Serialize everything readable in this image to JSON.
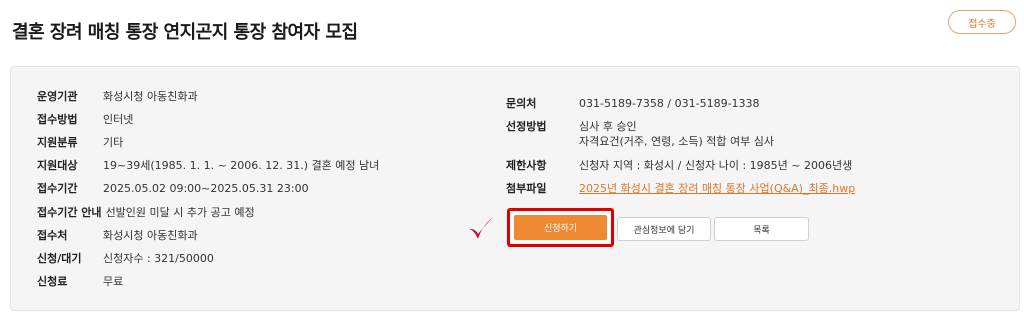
{
  "header": {
    "title": "결혼 장려 매칭 통장 연지곤지 통장 참여자 모집",
    "status": "접수중"
  },
  "info_left": [
    {
      "label": "운영기관",
      "value": "화성시청 아동친화과"
    },
    {
      "label": "접수방법",
      "value": "인터넷"
    },
    {
      "label": "지원분류",
      "value": "기타"
    },
    {
      "label": "지원대상",
      "value": "19~39세(1985. 1. 1. ~ 2006. 12. 31.) 결혼 예정 남녀"
    },
    {
      "label": "접수기간",
      "value": "2025.05.02 09:00~2025.05.31 23:00"
    },
    {
      "label": "접수기간 안내",
      "value": "선발인원 미달 시 추가 공고 예정"
    },
    {
      "label": "접수처",
      "value": "화성시청 아동친화과"
    },
    {
      "label": "신청/대기",
      "value": "신청자수 : 321/50000"
    },
    {
      "label": "신청료",
      "value": "무료"
    }
  ],
  "info_right": {
    "contact": {
      "label": "문의처",
      "value": "031-5189-7358 / 031-5189-1338"
    },
    "selection": {
      "label": "선정방법",
      "line1": "심사 후 승인",
      "line2": "자격요건(거주, 연령, 소득) 적합 여부 심사"
    },
    "restriction": {
      "label": "제한사항",
      "value": "신청자 지역 : 화성시 / 신청자 나이 : 1985년 ~ 2006년생"
    },
    "attachment": {
      "label": "첨부파일",
      "value": "2025년 화성시 결혼 장려 매칭 통장 사업(Q&A)_최종.hwp"
    }
  },
  "buttons": {
    "apply": "신청하기",
    "interest": "관심정보에 담기",
    "list": "목록"
  },
  "colors": {
    "accent": "#ef8a32",
    "highlight_box": "#e00000",
    "check_mark": "#d0103a"
  }
}
